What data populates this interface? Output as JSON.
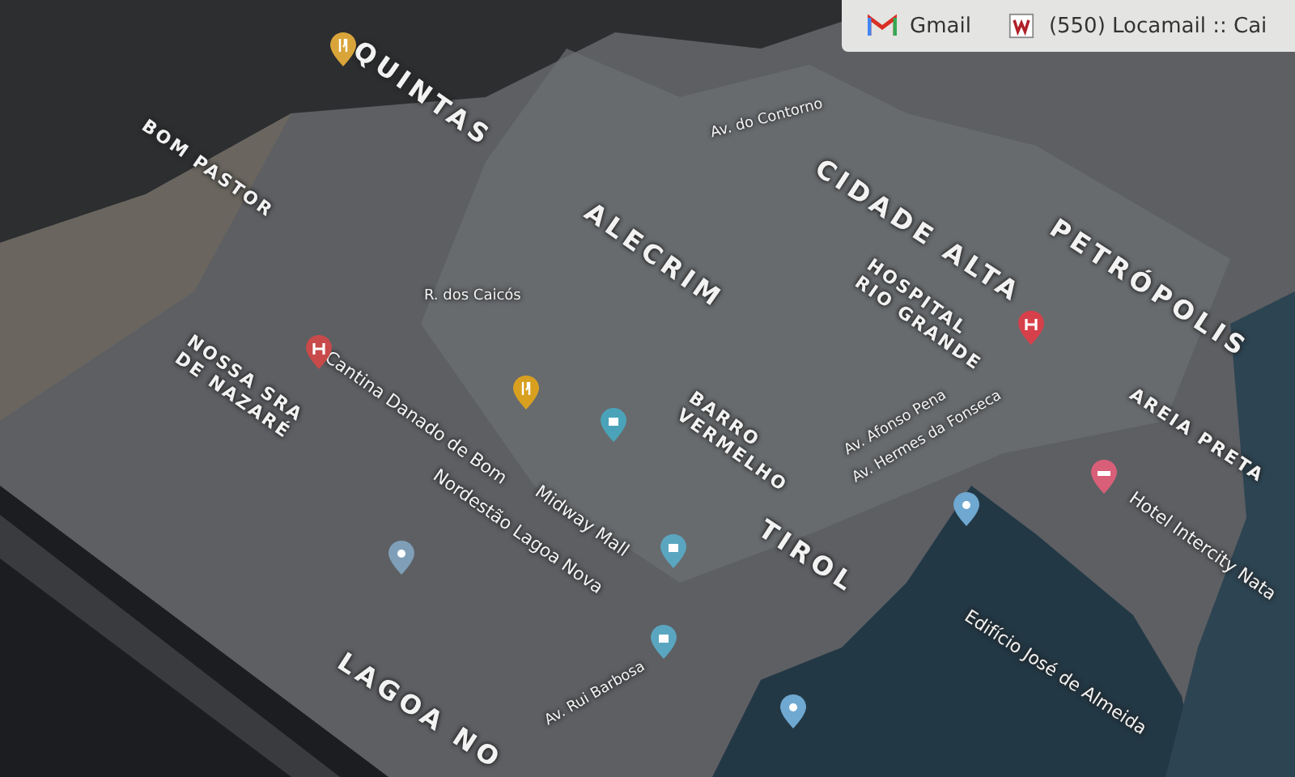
{
  "browser_tabs": [
    {
      "kind": "gmail",
      "label": "Gmail",
      "selected": false
    },
    {
      "kind": "mail",
      "label": "(550) Locamail :: Cai",
      "selected": false
    }
  ],
  "map": {
    "labels": [
      {
        "kind": "district",
        "text": "QUINTAS"
      },
      {
        "kind": "area",
        "text": "BOM PASTOR"
      },
      {
        "kind": "district",
        "text": "ALECRIM"
      },
      {
        "kind": "street",
        "text": "R. dos Caicós"
      },
      {
        "kind": "place",
        "text": "Cantina Danado de Bom"
      },
      {
        "kind": "area",
        "text": "NOSSA SRA\nDE NAZARÉ"
      },
      {
        "kind": "street",
        "text": "Av. do Contorno"
      },
      {
        "kind": "district",
        "text": "CIDADE ALTA"
      },
      {
        "kind": "district",
        "text": "PETRÓPOLIS"
      },
      {
        "kind": "area",
        "text": "HOSPITAL\nRIO GRANDE"
      },
      {
        "kind": "area",
        "text": "AREIA PRETA"
      },
      {
        "kind": "area",
        "text": "BARRO\nVERMELHO"
      },
      {
        "kind": "street",
        "text": "Av. Afonso Pena"
      },
      {
        "kind": "street",
        "text": "Av. Hermes da Fonseca"
      },
      {
        "kind": "district",
        "text": "TIROL"
      },
      {
        "kind": "place",
        "text": "Midway Mall"
      },
      {
        "kind": "place",
        "text": "Nordestão Lagoa Nova"
      },
      {
        "kind": "place",
        "text": "Edifício José de Almeida"
      },
      {
        "kind": "place",
        "text": "Hotel Intercity Nata"
      },
      {
        "kind": "district",
        "text": "LAGOA NO"
      },
      {
        "kind": "street",
        "text": "Av. Rui Barbosa"
      }
    ],
    "pins": [
      {
        "kind": "food",
        "color": "#d9a53a"
      },
      {
        "kind": "food",
        "color": "#d9a020"
      },
      {
        "kind": "shop",
        "color": "#4aa3b8"
      },
      {
        "kind": "hospital",
        "color": "#c84a4a"
      },
      {
        "kind": "hospital",
        "color": "#d6404a"
      },
      {
        "kind": "hotel",
        "color": "#d95f78"
      },
      {
        "kind": "shop",
        "color": "#5aa6c0"
      },
      {
        "kind": "shop",
        "color": "#5aa6c0"
      },
      {
        "kind": "place",
        "color": "#6fa8d0"
      },
      {
        "kind": "place",
        "color": "#7f9fb8"
      },
      {
        "kind": "place",
        "color": "#6fa8d0"
      }
    ]
  }
}
